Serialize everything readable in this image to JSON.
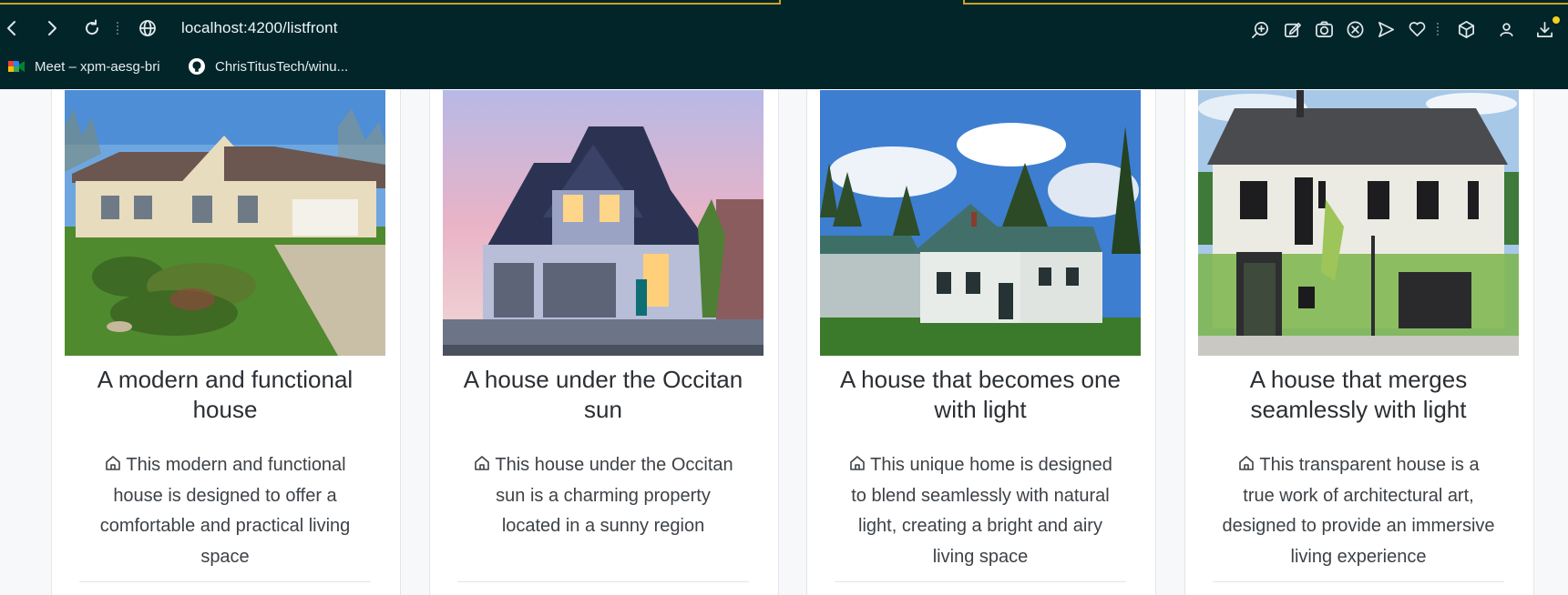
{
  "browser": {
    "url": "localhost:4200/listfront",
    "bookmarks": [
      {
        "label": "Meet – xpm-aesg-bri",
        "icon": "google-meet-icon"
      },
      {
        "label": "ChrisTitusTech/winu...",
        "icon": "github-icon"
      }
    ],
    "toolbar_icons": [
      "zoom-in-icon",
      "edit-icon",
      "camera-icon",
      "blocked-icon",
      "send-icon",
      "heart-icon",
      "extensions-cube-icon",
      "profile-icon",
      "download-icon"
    ],
    "accent_color": "#f2d21e",
    "chrome_color": "#02252a"
  },
  "houses": [
    {
      "title": "A modern and functional house",
      "description": "This modern and functional house is designed to offer a comfortable and practical living space",
      "icon": "home-icon"
    },
    {
      "title": "A house under the Occitan sun",
      "description": "This house under the Occitan sun is a charming property located in a sunny region",
      "icon": "home-icon"
    },
    {
      "title": "A house that becomes one with light",
      "description": "This unique home is designed to blend seamlessly with natural light, creating a bright and airy living space",
      "icon": "home-icon"
    },
    {
      "title": "A house that merges seamlessly with light",
      "description": "This transparent house is a true work of architectural art, designed to provide an immersive living experience",
      "icon": "home-icon"
    }
  ]
}
